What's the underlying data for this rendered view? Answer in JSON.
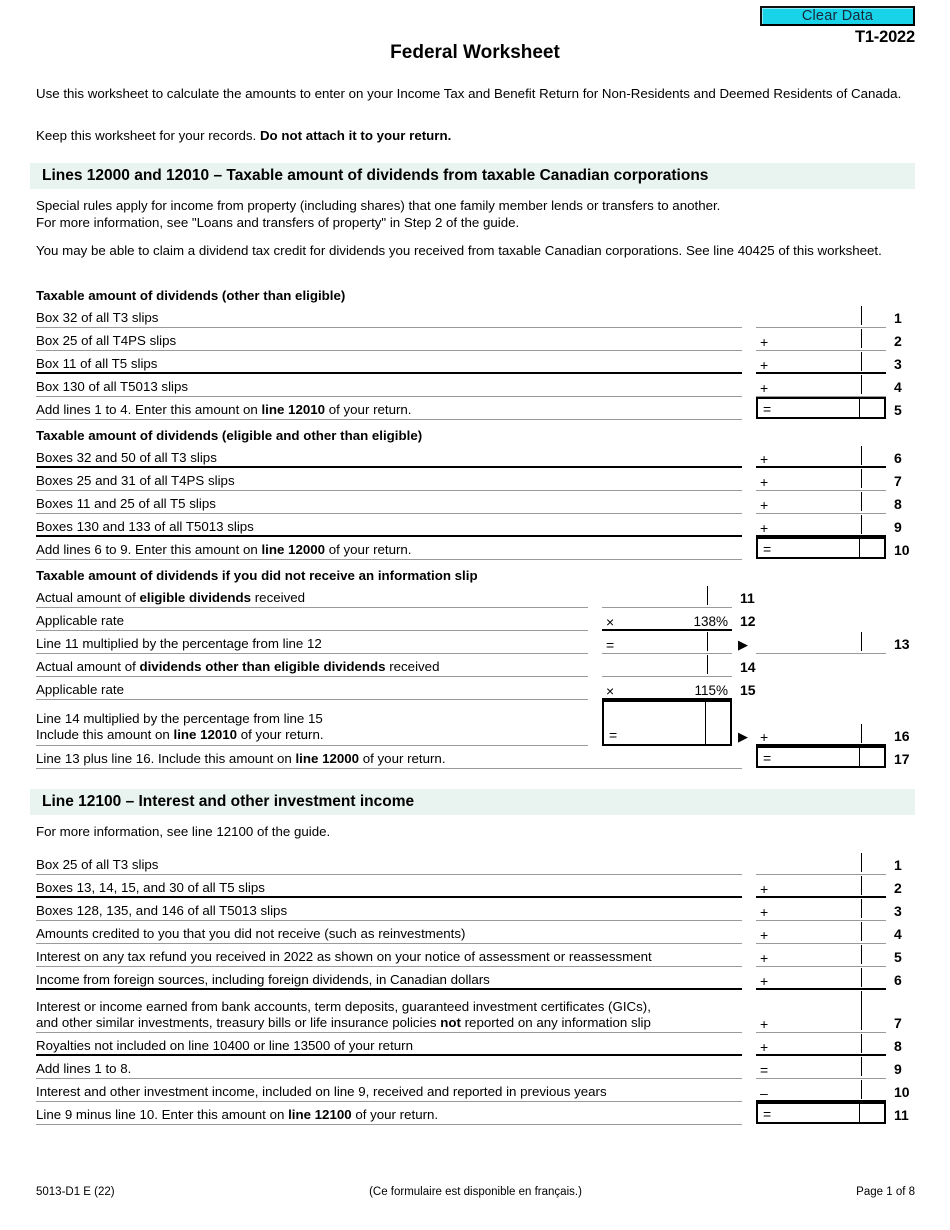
{
  "header": {
    "clear_data_label": "Clear Data",
    "form_year": "T1-2022",
    "title": "Federal Worksheet",
    "intro_1": "Use this worksheet to calculate the amounts to enter on your Income Tax and Benefit Return for Non-Residents and Deemed Residents of Canada.",
    "intro_2_plain": "Keep this worksheet for your records. ",
    "intro_2_bold": "Do not attach it to your return."
  },
  "section_dividends": {
    "band_title": "Lines 12000 and 12010 – Taxable amount of dividends from taxable Canadian corporations",
    "para_1_line_1": "Special rules apply for income from property (including shares) that one family member lends or transfers to another.",
    "para_1_line_2": "For more information, see \"Loans and transfers of property\" in Step 2 of the guide.",
    "para_2": "You may be able to claim a dividend tax credit for dividends you received from taxable Canadian corporations. See line 40425 of this worksheet.",
    "subhead_1": "Taxable amount of dividends (other than eligible)",
    "rows_1": [
      {
        "label": "Box 32 of all T3 slips",
        "op": "",
        "lineno": "1"
      },
      {
        "label": "Box 25 of all T4PS slips",
        "op": "+",
        "lineno": "2"
      },
      {
        "label": "Box 11 of all T5 slips",
        "op": "+",
        "lineno": "3"
      },
      {
        "label": "Box 130 of all T5013 slips",
        "op": "+",
        "lineno": "4"
      }
    ],
    "total_1": {
      "label_a": "Add lines 1 to 4. Enter this amount on ",
      "label_b": "line 12010",
      "label_c": " of your return.",
      "op": "=",
      "lineno": "5"
    },
    "subhead_2": "Taxable amount of dividends (eligible and other than eligible)",
    "rows_2": [
      {
        "label": "Boxes 32 and 50 of all T3 slips",
        "op": "+",
        "lineno": "6"
      },
      {
        "label": "Boxes 25 and 31 of all T4PS slips",
        "op": "+",
        "lineno": "7"
      },
      {
        "label": "Boxes 11 and 25 of all T5 slips",
        "op": "+",
        "lineno": "8"
      },
      {
        "label": "Boxes 130 and 133 of all T5013 slips",
        "op": "+",
        "lineno": "9"
      }
    ],
    "total_2": {
      "label_a": "Add lines 6 to 9. Enter this amount on ",
      "label_b": "line 12000",
      "label_c": " of your return.",
      "op": "=",
      "lineno": "10"
    },
    "subhead_3": "Taxable amount of dividends if you did not receive an information slip",
    "line11": {
      "label_a": "Actual amount of ",
      "label_b": "eligible dividends",
      "label_c": " received",
      "lineno": "11"
    },
    "line12": {
      "label": "Applicable rate",
      "op": "×",
      "value": "138%",
      "lineno": "12"
    },
    "line13": {
      "label": "Line 11 multiplied by the percentage from line 12",
      "op_inner": "=",
      "arrow": "▶",
      "lineno": "13"
    },
    "line14": {
      "label_a": "Actual amount of ",
      "label_b": "dividends other than eligible dividends",
      "label_c": " received",
      "lineno": "14"
    },
    "line15": {
      "label": "Applicable rate",
      "op": "×",
      "value": "115%",
      "lineno": "15"
    },
    "line16": {
      "label_1": "Line 14 multiplied by the percentage from line 15",
      "label_2a": "Include this amount on ",
      "label_2b": "line 12010",
      "label_2c": " of your return.",
      "op_inner": "=",
      "arrow": "▶",
      "op_outer": "+",
      "lineno": "16"
    },
    "line17": {
      "label_a": "Line 13 plus line 16. Include this amount on ",
      "label_b": "line 12000",
      "label_c": " of your return.",
      "op": "=",
      "lineno": "17"
    }
  },
  "section_interest": {
    "band_title": "Line 12100 – Interest and other investment income",
    "para": "For more information, see line 12100 of the guide.",
    "rows": [
      {
        "label": "Box 25 of all T3 slips",
        "op": "",
        "lineno": "1"
      },
      {
        "label": "Boxes 13, 14, 15, and 30 of all T5 slips",
        "op": "+",
        "lineno": "2"
      },
      {
        "label": "Boxes 128, 135, and 146 of all T5013 slips",
        "op": "+",
        "lineno": "3"
      },
      {
        "label": "Amounts credited to you that you did not receive (such as reinvestments)",
        "op": "+",
        "lineno": "4"
      },
      {
        "label": "Interest on any tax refund you received in 2022 as shown on your notice of assessment or reassessment",
        "op": "+",
        "lineno": "5"
      },
      {
        "label": "Income from foreign sources, including foreign dividends, in Canadian dollars",
        "op": "+",
        "lineno": "6"
      }
    ],
    "row7": {
      "label_1": "Interest or income earned from bank accounts, term deposits, guaranteed investment certificates (GICs),",
      "label_2a": "and other similar investments, treasury bills or life insurance policies ",
      "label_2b": "not",
      "label_2c": " reported on any information slip",
      "op": "+",
      "lineno": "7"
    },
    "row8": {
      "label": "Royalties not included on line 10400 or line 13500 of your return",
      "op": "+",
      "lineno": "8"
    },
    "row9": {
      "label": "Add lines 1 to 8.",
      "op": "=",
      "lineno": "9"
    },
    "row10": {
      "label": "Interest and other investment income, included on line 9, received and reported in previous years",
      "op": "–",
      "lineno": "10"
    },
    "row11": {
      "label_a": "Line 9 minus line 10. Enter this amount on ",
      "label_b": "line 12100",
      "label_c": " of your return.",
      "op": "=",
      "lineno": "11"
    }
  },
  "footer": {
    "form_code": "5013-D1 E (22)",
    "french_note": "(Ce formulaire est disponible en français.)",
    "page_label": "Page 1 of 8"
  },
  "colors": {
    "band_background": "#e9f3f0",
    "clear_data_background": "#19d3e8",
    "rule_light": "#9a9a9a",
    "rule_dark": "#000000"
  }
}
